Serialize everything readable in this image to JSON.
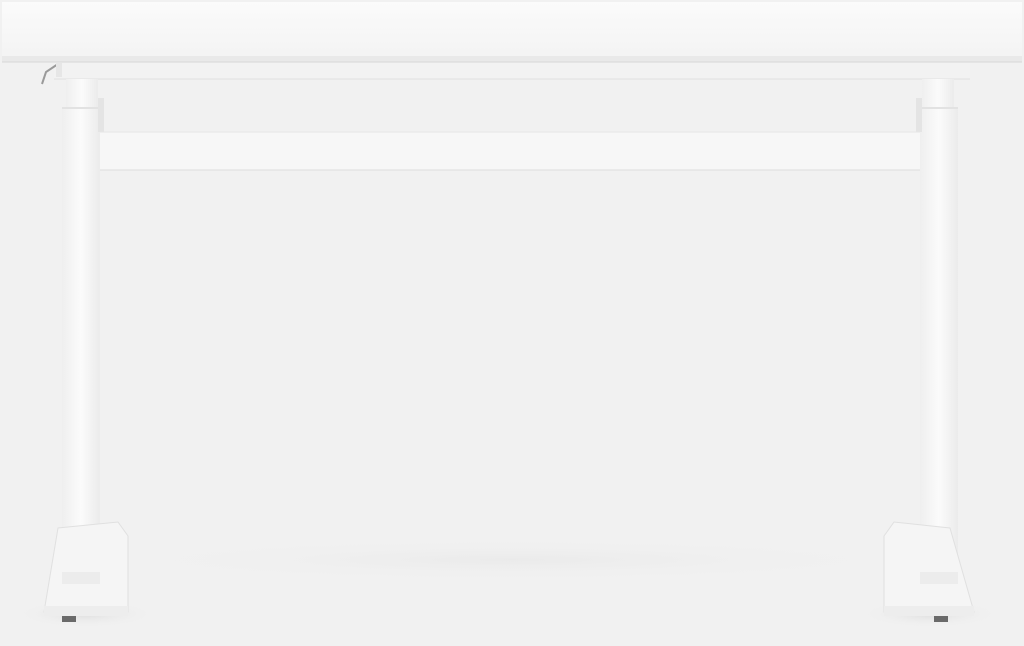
{
  "image": {
    "subject": "white-height-adjustable-desk",
    "colors": {
      "background": "#f1f1f1",
      "desk_white": "#fafafa",
      "frame_white": "#f6f6f6",
      "shadow": "#e2e2e2",
      "edge": "#d9d9d9",
      "foot_pad": "#6a6a6a"
    }
  }
}
